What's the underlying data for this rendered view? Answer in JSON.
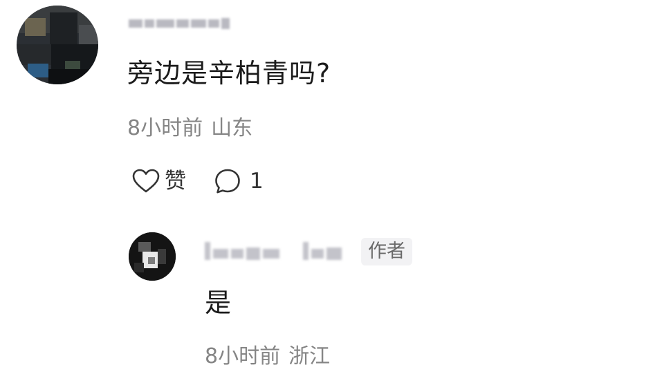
{
  "comment": {
    "username": "",
    "text": "旁边是辛柏青吗?",
    "time": "8小时前",
    "location": "山东",
    "like_label": "赞",
    "reply_count": "1",
    "icons": {
      "like": "heart-outline-icon",
      "reply": "speech-bubble-icon"
    }
  },
  "reply": {
    "username": "",
    "author_badge": "作者",
    "text": "是",
    "time": "8小时前",
    "location": "浙江"
  },
  "colors": {
    "background": "#ffffff",
    "primary_text": "#1b1b1b",
    "meta_text": "#858585",
    "icon": "#333333",
    "badge_bg": "#f2f2f4",
    "badge_text": "#6a6a6a"
  }
}
